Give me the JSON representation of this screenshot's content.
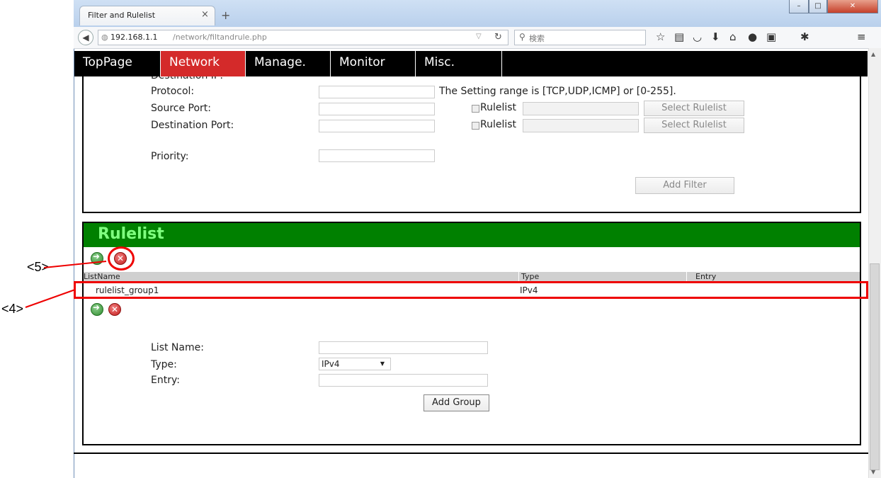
{
  "browser": {
    "tab_title": "Filter and Rulelist",
    "tab_close": "×",
    "new_tab": "+",
    "url_host": "192.168.1.1",
    "url_path": "/network/filtandrule.php",
    "search_placeholder": "検索"
  },
  "menu": {
    "items": [
      {
        "label": "TopPage",
        "active": false
      },
      {
        "label": "Network",
        "active": true
      },
      {
        "label": "Manage.",
        "active": false
      },
      {
        "label": "Monitor",
        "active": false
      },
      {
        "label": "Misc.",
        "active": false
      }
    ]
  },
  "filter_form": {
    "destination_ip_label": "Destination IP:",
    "protocol_label": "Protocol:",
    "protocol_hint": "The Setting range is [TCP,UDP,ICMP] or [0-255].",
    "source_port_label": "Source Port:",
    "destination_port_label": "Destination Port:",
    "priority_label": "Priority:",
    "rulelist_label": "Rulelist",
    "select_rulelist_label": "Select Rulelist",
    "add_filter_label": "Add Filter"
  },
  "rulelist": {
    "header": "Rulelist",
    "columns": [
      "ListName",
      "Type",
      "Entry"
    ],
    "rows": [
      {
        "list_name": "rulelist_group1",
        "type": "IPv4",
        "entry": ""
      }
    ],
    "form": {
      "list_name_label": "List Name:",
      "type_label": "Type:",
      "type_value": "IPv4",
      "entry_label": "Entry:",
      "add_group_label": "Add Group"
    }
  },
  "annotations": {
    "label_5": "<5>",
    "label_4": "<4>"
  },
  "colors": {
    "active_menu": "#d42a2a",
    "rulelist_header_bg": "#008000",
    "rulelist_header_text": "#7fff7f",
    "annotation_red": "#e00000"
  }
}
